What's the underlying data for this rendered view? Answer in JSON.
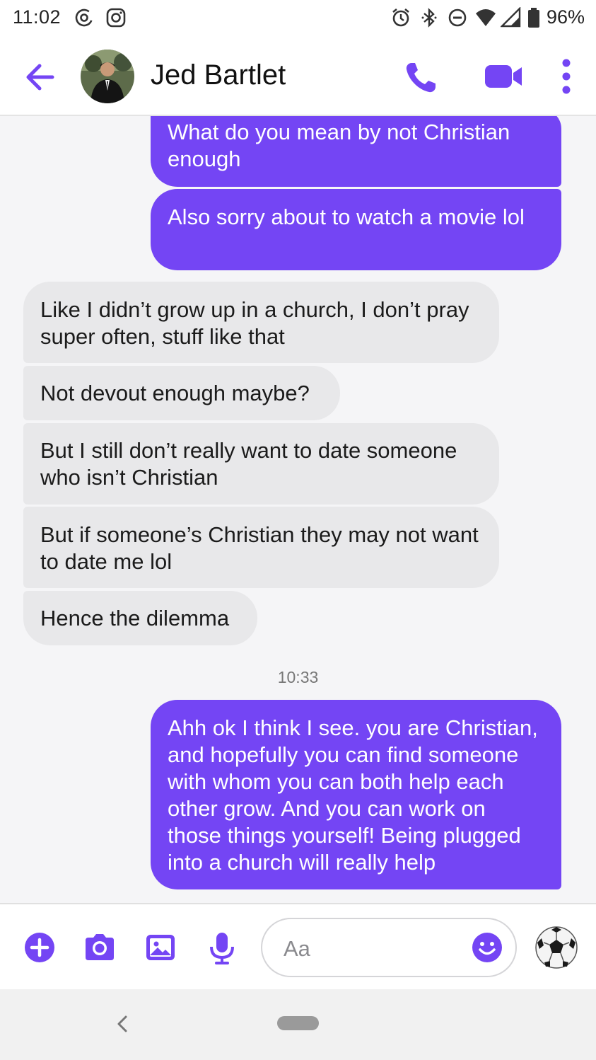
{
  "status_bar": {
    "time": "11:02",
    "battery_percent": "96%",
    "icons": [
      "at-icon",
      "instagram-icon",
      "alarm-icon",
      "bluetooth-icon",
      "do-not-disturb-icon",
      "wifi-icon",
      "signal-icon",
      "battery-icon"
    ]
  },
  "header": {
    "contact_name": "Jed Bartlet",
    "accent_color": "#7445f4"
  },
  "messages": [
    {
      "from": "me",
      "text": "What do you mean by not Christian enough"
    },
    {
      "from": "me",
      "text": "Also sorry about to watch a movie lol"
    },
    {
      "from": "them",
      "text": "Like I didn’t grow up in a church, I don’t pray super often, stuff like that"
    },
    {
      "from": "them",
      "text": "Not devout enough maybe?"
    },
    {
      "from": "them",
      "text": "But I still don’t really want to date someone who isn’t Christian"
    },
    {
      "from": "them",
      "text": "But if someone’s Christian they may not want to date me lol"
    },
    {
      "from": "them",
      "text": "Hence the dilemma"
    },
    {
      "from": "me",
      "text": "Ahh ok I think I see. you are Christian, and hopefully you can find someone with whom you can both help each other grow. And you can work on those things yourself! Being plugged into a church will really help"
    }
  ],
  "timestamp": "10:33",
  "composer": {
    "placeholder": "Aa",
    "icons": [
      "plus-icon",
      "camera-icon",
      "image-icon",
      "microphone-icon",
      "emoji-icon",
      "soccer-ball-icon"
    ]
  },
  "colors": {
    "sent_bubble": "#7445f4",
    "received_bubble": "#e8e8ea"
  }
}
